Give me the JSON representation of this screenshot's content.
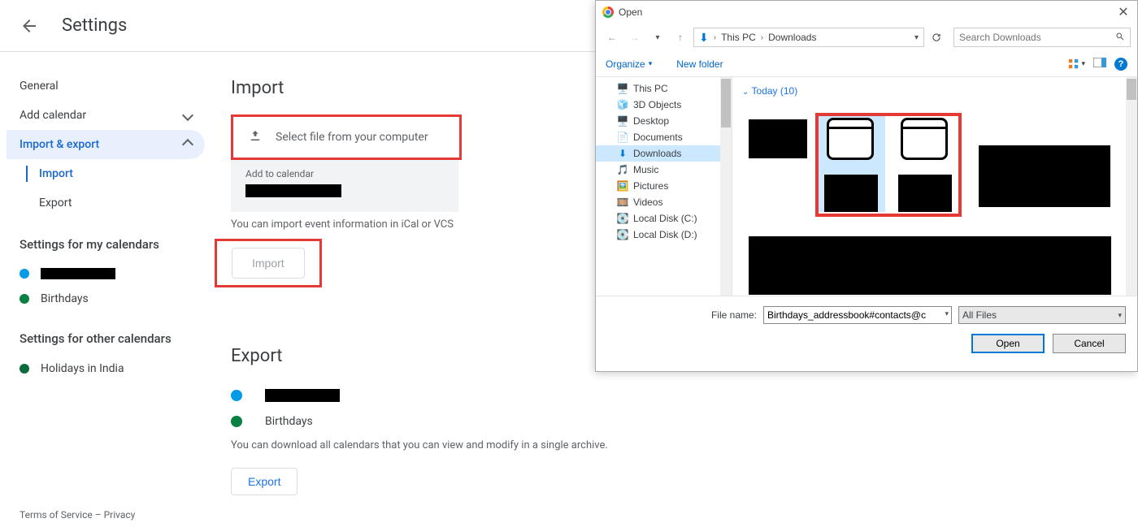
{
  "header": {
    "title": "Settings"
  },
  "sidebar": {
    "general": "General",
    "add_calendar": "Add calendar",
    "import_export": "Import & export",
    "import": "Import",
    "export": "Export",
    "my_cal_heading": "Settings for my calendars",
    "birthdays": "Birthdays",
    "other_cal_heading": "Settings for other calendars",
    "holidays": "Holidays in India"
  },
  "footer": {
    "terms": "Terms of Service",
    "sep": " – ",
    "privacy": "Privacy"
  },
  "import": {
    "heading": "Import",
    "select_file": "Select file from your computer",
    "add_to_calendar": "Add to calendar",
    "ical_note": "You can import event information in iCal or VCS",
    "import_btn": "Import"
  },
  "export": {
    "heading": "Export",
    "birthdays": "Birthdays",
    "note": "You can download all calendars that you can view and modify in a single archive.",
    "export_btn": "Export"
  },
  "dialog": {
    "title": "Open",
    "breadcrumb": {
      "root": "This PC",
      "current": "Downloads"
    },
    "search_placeholder": "Search Downloads",
    "organize": "Organize",
    "new_folder": "New folder",
    "tree": {
      "this_pc": "This PC",
      "objects3d": "3D Objects",
      "desktop": "Desktop",
      "documents": "Documents",
      "downloads": "Downloads",
      "music": "Music",
      "pictures": "Pictures",
      "videos": "Videos",
      "disk_c": "Local Disk (C:)",
      "disk_d": "Local Disk (D:)"
    },
    "group_today": "Today (10)",
    "filename_label": "File name:",
    "filename_value": "Birthdays_addressbook#contacts@c",
    "filetype": "All Files",
    "open_btn": "Open",
    "cancel_btn": "Cancel"
  }
}
